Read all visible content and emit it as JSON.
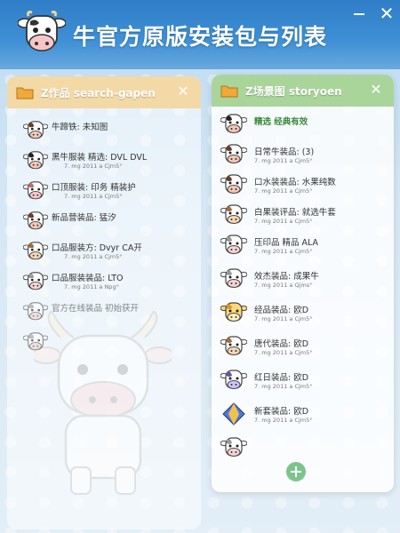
{
  "window": {
    "title": "牛官方原版安装包与列表",
    "minimize_icon": "minimize-icon",
    "close_icon": "close-icon"
  },
  "colors": {
    "titlebar": "#3f90d6",
    "left_header": "#f3d9a6",
    "right_header": "#a9d59a",
    "add_button": "#7cc48b"
  },
  "left_panel": {
    "title": "Z作品 search-gapen",
    "items": [
      {
        "name": "牛蹄铁:  未知图",
        "meta": "",
        "cow": "cow-brown"
      },
      {
        "name": "黑牛服装  精选:  DVL  DVL",
        "meta": "7. mg 2011 a Cjm5°",
        "cow": "cow-black"
      },
      {
        "name": "口顶服装:  印务  精装护",
        "meta": "7. mg 2011 a Cjm5°",
        "cow": "cow-pink"
      },
      {
        "name": "新品营装品:  猛汐",
        "meta": "",
        "cow": "cow-brown"
      },
      {
        "name": "口品服装方:  Dvyr  CA开",
        "meta": "7. mg 2011 a Cjm5°",
        "cow": "cow-tan"
      },
      {
        "name": "口品服装装品:  LTO",
        "meta": "7. mg 2011 a Npg°",
        "cow": "cow-white"
      },
      {
        "name": "官方在线装品  初始获开",
        "meta": "",
        "cow": "cow-white"
      },
      {
        "name": "",
        "meta": "",
        "cow": "cow-white"
      }
    ]
  },
  "right_panel": {
    "title": "Z场景图  storyoen",
    "header_item": {
      "name": "精选  经典有效"
    },
    "items": [
      {
        "name": "日常牛装品:  (3)",
        "meta": "7. mg 2011 a Cjm5°",
        "cow": "cow-brown"
      },
      {
        "name": "口水装装品:  水果纯数",
        "meta": "7. mg 2011 a Cjm5°",
        "cow": "cow-brown"
      },
      {
        "name": "白果装评品:  就选牛套",
        "meta": "7. mg 2011 a Cjm5°",
        "cow": "cow-tan"
      },
      {
        "name": "压印品  精品  ALA",
        "meta": "7. mg 2011 a Cjm5°",
        "cow": "cow-white"
      },
      {
        "name": "效杰装品:  成果牛",
        "meta": "7. mg 2011 a Qjms°",
        "cow": "cow-white"
      },
      {
        "name": "经品装品:  欧D",
        "meta": "7. mg 2011 a Cjm5°",
        "cow": "cow-yellow"
      },
      {
        "name": "唐代装品:  欧D",
        "meta": "7. mg 2011 a Cjm5°",
        "cow": "cow-tan"
      },
      {
        "name": "红日装品:  欧D",
        "meta": "7. mg 2011 a Cjm5°",
        "cow": "cow-purple"
      },
      {
        "name": "新套装品:  欧D",
        "meta": "7. mg 2011 a Cjm5°",
        "cow": "diamond-icon"
      },
      {
        "name": "",
        "meta": "",
        "cow": "cow-white"
      }
    ],
    "add_icon": "plus-circle-icon"
  }
}
